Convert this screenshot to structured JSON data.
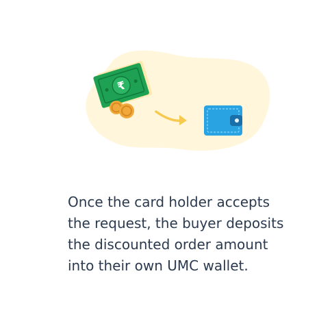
{
  "step": {
    "description": "Once the card holder accepts the request, the buyer deposits the discounted order amount into their own UMC wallet.",
    "currency_symbol": "₹"
  },
  "icons": {
    "cash": "banknote-icon",
    "coins": "coins-icon",
    "arrow": "arrow-right-icon",
    "wallet": "wallet-icon"
  },
  "colors": {
    "background_blob": "#fff6dc",
    "banknote": "#1ea152",
    "coin": "#f0a93a",
    "arrow": "#f7c94f",
    "wallet": "#2aa3e3",
    "text": "#2b3a4e"
  }
}
